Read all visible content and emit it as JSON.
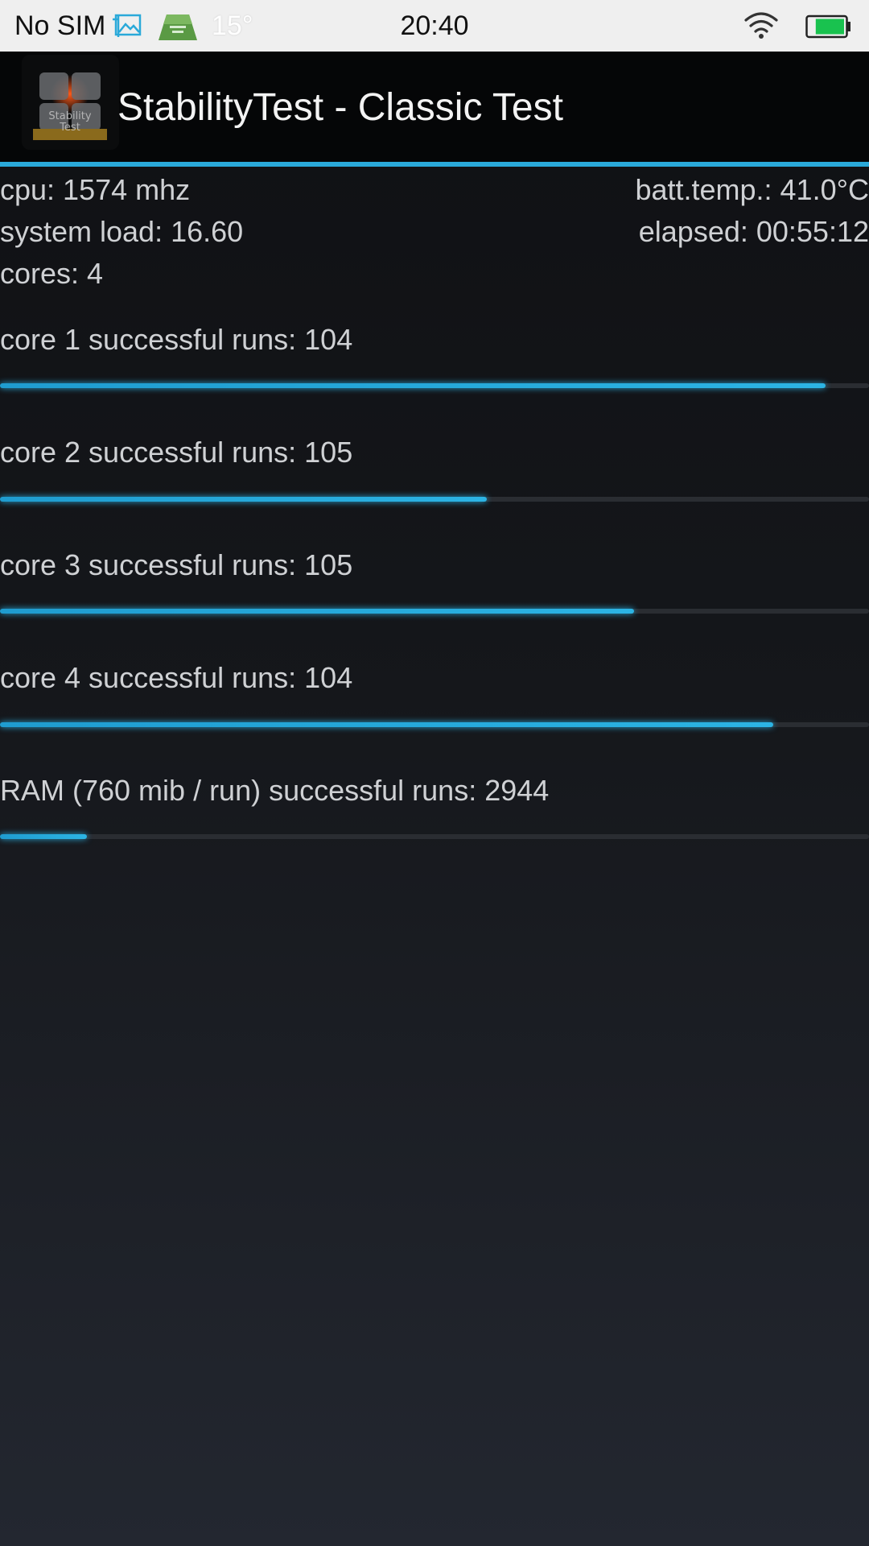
{
  "status_bar": {
    "carrier": "No SIM",
    "temperature": "15°",
    "time": "20:40",
    "battery_level": 0.8,
    "icons": [
      "photo-icon",
      "stabilitytest-notification-icon",
      "wifi-icon",
      "battery-icon"
    ]
  },
  "app": {
    "title": "StabilityTest - Classic Test",
    "logo_text": "Stability Test",
    "accent_color": "#2aa9d9"
  },
  "info": {
    "cpu": "cpu: 1574 mhz",
    "batt_temp": "batt.temp.: 41.0°C",
    "system_load": "system load: 16.60",
    "elapsed": "elapsed: 00:55:12",
    "cores": "cores: 4"
  },
  "runs": [
    {
      "label": "core 1 successful runs: 104",
      "progress": 0.95
    },
    {
      "label": "core 2 successful runs: 105",
      "progress": 0.56
    },
    {
      "label": "core 3 successful runs: 105",
      "progress": 0.73
    },
    {
      "label": "core 4 successful runs: 104",
      "progress": 0.89
    },
    {
      "label": "RAM (760 mib / run) successful runs: 2944",
      "progress": 0.1
    }
  ]
}
